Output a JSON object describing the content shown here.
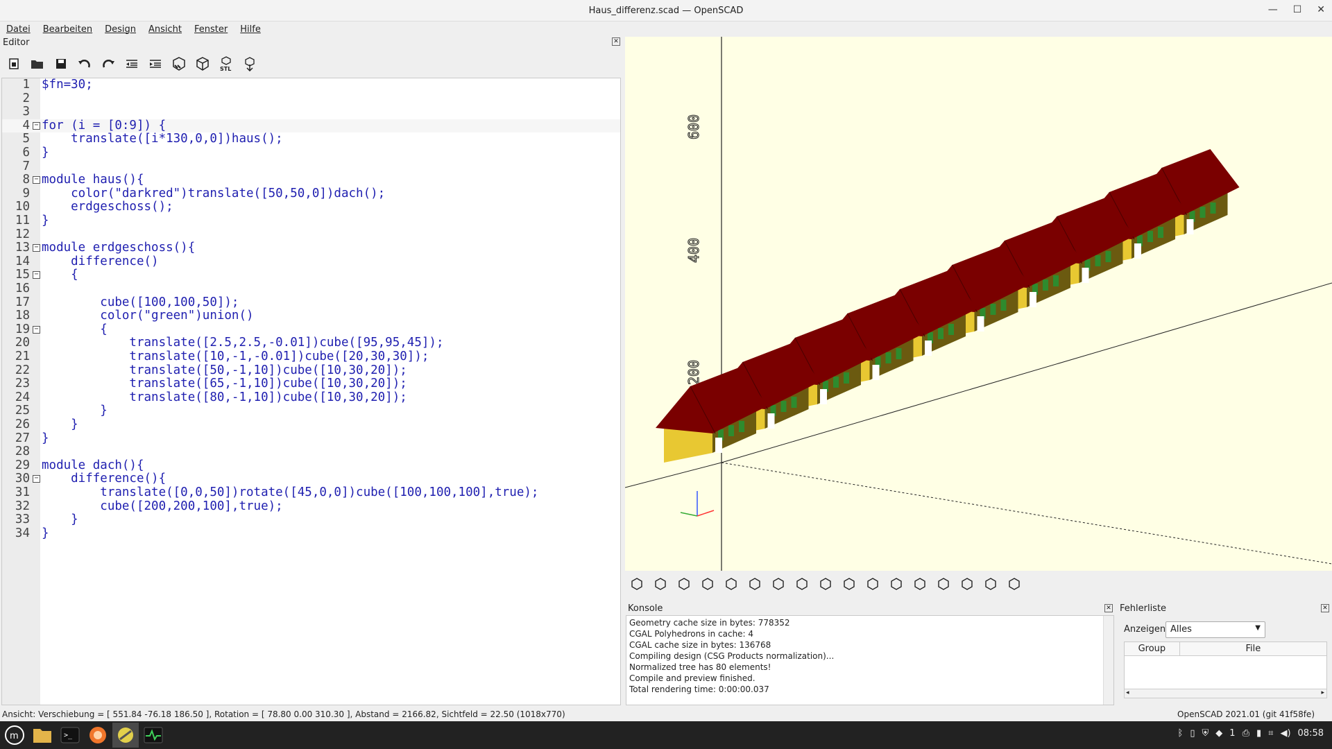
{
  "window": {
    "title": "Haus_differenz.scad — OpenSCAD"
  },
  "menu": [
    "Datei",
    "Bearbeiten",
    "Design",
    "Ansicht",
    "Fenster",
    "Hilfe"
  ],
  "editor": {
    "title": "Editor",
    "toolbar": [
      "new-file-icon",
      "open-file-icon",
      "save-icon",
      "undo-icon",
      "redo-icon",
      "unindent-icon",
      "indent-icon",
      "preview-icon",
      "render-icon",
      "export-stl-icon",
      "send-to-3d-print-icon"
    ],
    "lines": [
      "$fn=30;",
      "",
      "",
      "for (i = [0:9]) {",
      "    translate([i*130,0,0])haus();",
      "}",
      "",
      "module haus(){",
      "    color(\"darkred\")translate([50,50,0])dach();",
      "    erdgeschoss();",
      "}",
      "",
      "module erdgeschoss(){",
      "    difference()",
      "    {",
      "",
      "        cube([100,100,50]);",
      "        color(\"green\")union()",
      "        {",
      "            translate([2.5,2.5,-0.01])cube([95,95,45]);",
      "            translate([10,-1,-0.01])cube([20,30,30]);",
      "            translate([50,-1,10])cube([10,30,20]);",
      "            translate([65,-1,10])cube([10,30,20]);",
      "            translate([80,-1,10])cube([10,30,20]);",
      "        }",
      "    }",
      "}",
      "",
      "module dach(){",
      "    difference(){",
      "        translate([0,0,50])rotate([45,0,0])cube([100,100,100],true);",
      "        cube([200,200,100],true);",
      "    }",
      "}"
    ]
  },
  "viewport": {
    "axis_labels": [
      "600",
      "400",
      "200"
    ],
    "houses": 10,
    "colors": {
      "roof": "#7a0000",
      "wall": "#e8c832",
      "window": "#2e8b2e",
      "background": "#ffffe5"
    }
  },
  "view_toolbar": [
    "preview-icon",
    "render-icon",
    "view-all-icon",
    "zoom-in-icon",
    "zoom-out-icon",
    "reset-view-icon",
    "view-right-icon",
    "view-top-icon",
    "view-bottom-icon",
    "view-left-icon",
    "view-front-icon",
    "view-back-icon",
    "perspective-icon",
    "orthogonal-icon",
    "show-axes-icon",
    "show-scale-icon",
    "show-edges-icon"
  ],
  "konsole": {
    "title": "Konsole",
    "lines": [
      "Geometry cache size in bytes: 778352",
      "CGAL Polyhedrons in cache: 4",
      "CGAL cache size in bytes: 136768",
      "Compiling design (CSG Products normalization)...",
      "Normalized tree has 80 elements!",
      "Compile and preview finished.",
      "Total rendering time: 0:00:00.037"
    ]
  },
  "fehlerliste": {
    "title": "Fehlerliste",
    "filter_label": "Anzeigen",
    "filter_value": "Alles",
    "columns": [
      "Group",
      "File"
    ]
  },
  "status": {
    "view": "Ansicht: Verschiebung = [ 551.84 -76.18 186.50 ], Rotation = [ 78.80 0.00 310.30 ], Abstand = 2166.82, Sichtfeld = 22.50 (1018x770)",
    "version": "OpenSCAD 2021.01 (git 41f58fe)"
  },
  "taskbar": {
    "clock": "08:58",
    "count": "1",
    "apps": [
      "menu-icon",
      "files-icon",
      "terminal-icon",
      "firefox-icon",
      "openscad-icon",
      "system-monitor-icon"
    ]
  }
}
